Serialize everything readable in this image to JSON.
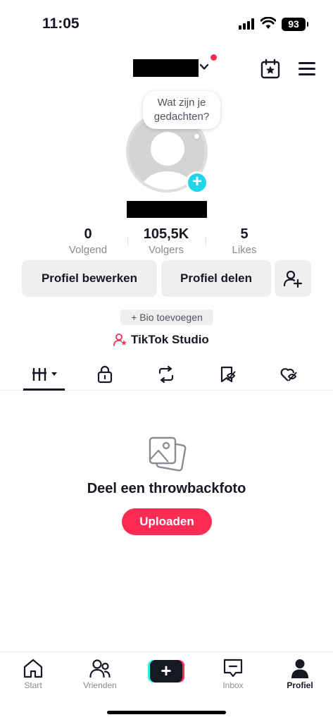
{
  "status_bar": {
    "time": "11:05",
    "battery": "93"
  },
  "header": {
    "username_redacted": true,
    "has_notification": true
  },
  "thought_bubble": {
    "line1": "Wat zijn je",
    "line2": "gedachten?"
  },
  "stats": [
    {
      "value": "0",
      "label": "Volgend"
    },
    {
      "value": "105,5K",
      "label": "Volgers"
    },
    {
      "value": "5",
      "label": "Likes"
    }
  ],
  "actions": {
    "edit_profile": "Profiel bewerken",
    "share_profile": "Profiel delen",
    "add_bio": "+ Bio toevoegen",
    "studio": "TikTok Studio"
  },
  "tabs": [
    {
      "icon": "videos-grid-icon",
      "active": true
    },
    {
      "icon": "lock-icon",
      "active": false
    },
    {
      "icon": "repost-icon",
      "active": false
    },
    {
      "icon": "favorites-icon",
      "active": false
    },
    {
      "icon": "liked-icon",
      "active": false
    }
  ],
  "empty_state": {
    "title": "Deel een throwbackfoto",
    "button": "Uploaden"
  },
  "bottom_nav": [
    {
      "label": "Start",
      "icon": "home-icon",
      "active": false
    },
    {
      "label": "Vrienden",
      "icon": "friends-icon",
      "active": false
    },
    {
      "label": "",
      "icon": "create-icon",
      "active": false
    },
    {
      "label": "Inbox",
      "icon": "inbox-icon",
      "active": false
    },
    {
      "label": "Profiel",
      "icon": "profile-icon",
      "active": true
    }
  ],
  "colors": {
    "accent": "#fe2c55",
    "cyan": "#20d5ec",
    "text": "#161823",
    "muted": "#8a8b91",
    "button_bg": "#efefef"
  }
}
